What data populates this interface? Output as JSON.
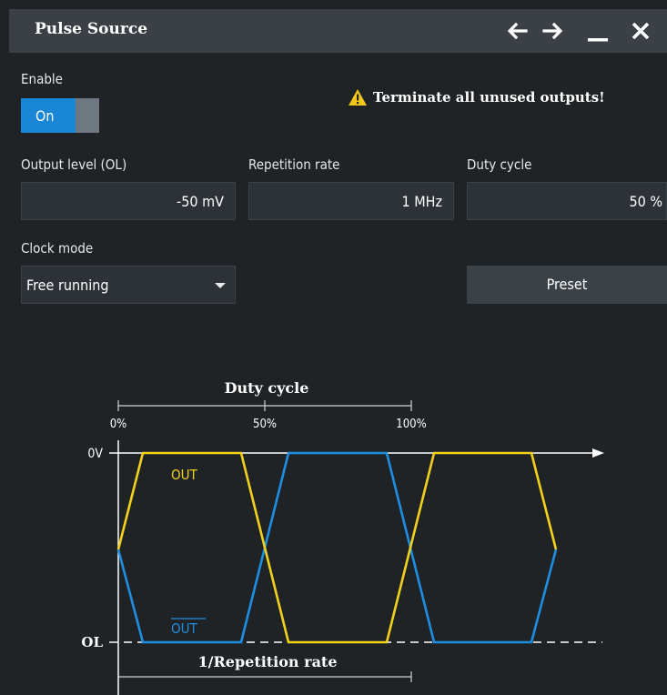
{
  "window": {
    "title": "Pulse Source"
  },
  "enable": {
    "label": "Enable",
    "state": "On"
  },
  "warning": {
    "text": "Terminate all unused outputs!"
  },
  "output_level": {
    "label": "Output level (OL)",
    "value": "-50 mV"
  },
  "repetition_rate": {
    "label": "Repetition rate",
    "value": "1 MHz"
  },
  "duty_cycle": {
    "label": "Duty cycle",
    "value": "50 %"
  },
  "clock_mode": {
    "label": "Clock mode",
    "value": "Free running"
  },
  "preset": {
    "label": "Preset"
  },
  "diagram": {
    "duty_cycle_title": "Duty cycle",
    "tick_0": "0%",
    "tick_50": "50%",
    "tick_100": "100%",
    "zero_v": "0V",
    "ol": "OL",
    "out": "OUT",
    "out_inverted": "OUT",
    "period_label": "1/Repetition rate",
    "out_color": "#f2d21b",
    "out_inverted_color": "#1e8fe0"
  }
}
